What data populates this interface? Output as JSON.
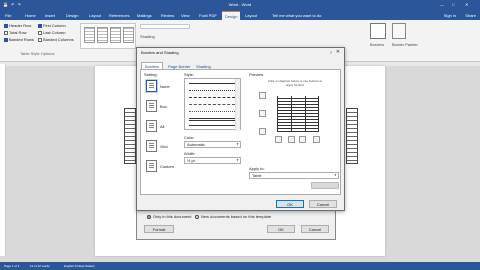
{
  "window": {
    "title": "Word - Word"
  },
  "tabs": [
    "File",
    "Home",
    "Insert",
    "Design",
    "Layout",
    "References",
    "Mailings",
    "Review",
    "View",
    "Foxit PDF",
    "Design",
    "Layout"
  ],
  "tell_me": "Tell me what you want to do",
  "sign_in": "Sign in",
  "share": "Share",
  "ribbon": {
    "style_options": [
      "Header Row",
      "Total Row",
      "Banded Rows",
      "First Column",
      "Last Column",
      "Banded Columns"
    ],
    "group_label": "Table Style Options",
    "shading_label": "Shading",
    "borders_label": "Borders",
    "painter_label": "Border Painter"
  },
  "back_dialog": {
    "radio_this_doc": "Only in this document",
    "radio_new_docs": "New documents based on this template",
    "format_button": "Format",
    "ok_button": "OK",
    "cancel_button": "Cancel"
  },
  "dialog": {
    "title": "Borders and Shading",
    "help": "?",
    "close": "✕",
    "tabs": [
      "Borders",
      "Page Border",
      "Shading"
    ],
    "setting_label": "Setting:",
    "settings": [
      "None",
      "Box",
      "All",
      "Grid",
      "Custom"
    ],
    "style_label": "Style:",
    "color_label": "Color:",
    "color_value": "Automatic",
    "width_label": "Width:",
    "width_value": "½ pt",
    "preview_label": "Preview",
    "preview_hint": "Click on diagram below or use buttons to apply borders",
    "apply_label": "Apply to:",
    "apply_value": "Table",
    "ok_button": "OK",
    "cancel_button": "Cancel"
  },
  "status": {
    "page": "Page 1 of 1",
    "words": "12 of 12 words",
    "lang": "English (United States)"
  }
}
